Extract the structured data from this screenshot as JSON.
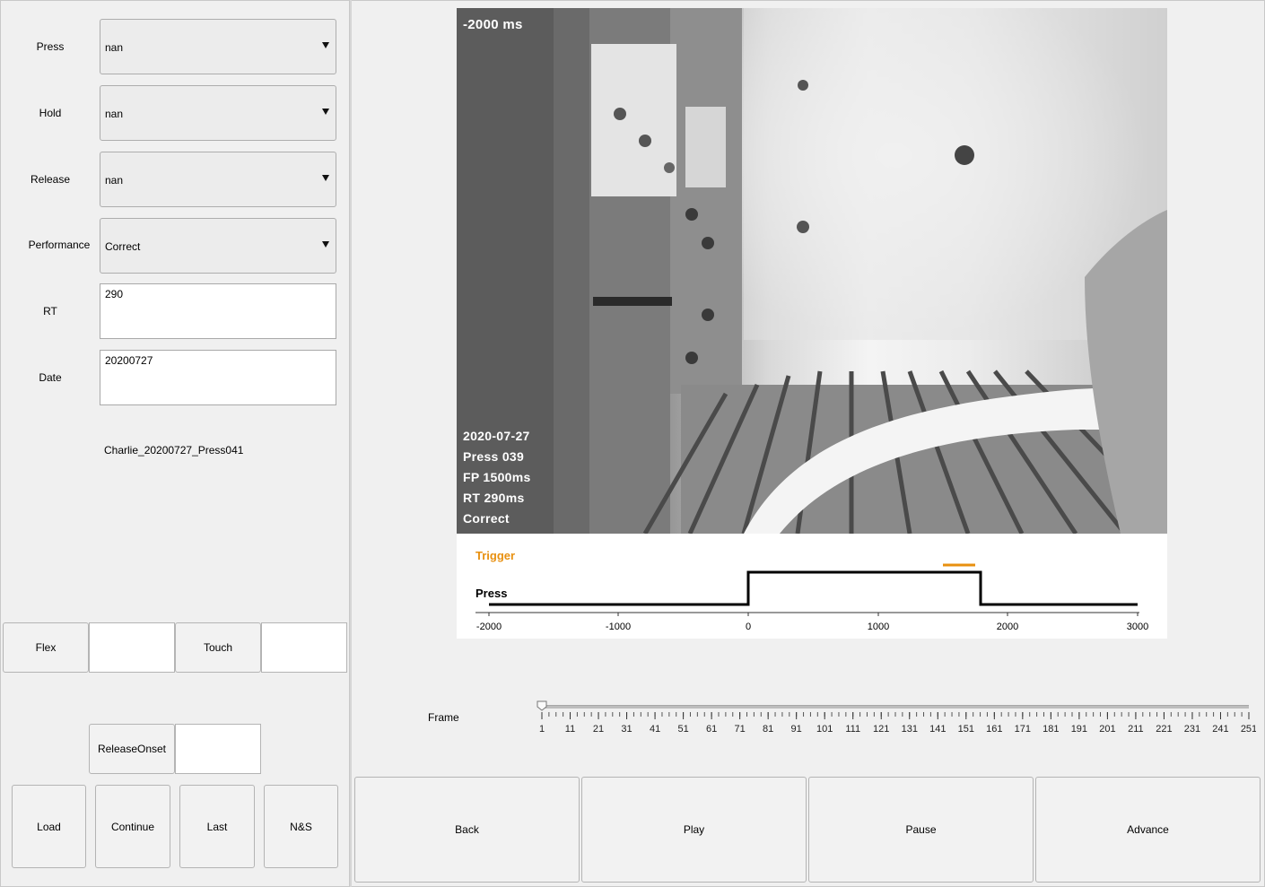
{
  "fields": {
    "press": {
      "label": "Press",
      "value": "nan"
    },
    "hold": {
      "label": "Hold",
      "value": "nan"
    },
    "release": {
      "label": "Release",
      "value": "nan"
    },
    "performance": {
      "label": "Performance",
      "value": "Correct"
    },
    "rt": {
      "label": "RT",
      "value": "290"
    },
    "date": {
      "label": "Date",
      "value": "20200727"
    }
  },
  "file_name": "Charlie_20200727_Press041",
  "buttons": {
    "flex": "Flex",
    "touch": "Touch",
    "release_onset": "ReleaseOnset",
    "load": "Load",
    "continue": "Continue",
    "last": "Last",
    "ns": "N&S",
    "back": "Back",
    "play": "Play",
    "pause": "Pause",
    "advance": "Advance"
  },
  "video": {
    "time_label": "-2000 ms",
    "time_color": "#f2d11a",
    "info_lines": [
      "2020-07-27",
      "Press 039",
      "FP 1500ms",
      "RT 290ms",
      "Correct"
    ]
  },
  "trace": {
    "trigger_label": "Trigger",
    "trigger_color": "#e8900f",
    "press_label": "Press",
    "x_ticks": [
      "-2000",
      "-1000",
      "0",
      "1000",
      "2000",
      "3000"
    ]
  },
  "frame": {
    "label": "Frame",
    "current": 1,
    "min": 1,
    "max": 251,
    "tick_labels": [
      "1",
      "11",
      "21",
      "31",
      "41",
      "51",
      "61",
      "71",
      "81",
      "91",
      "101",
      "111",
      "121",
      "131",
      "141",
      "151",
      "161",
      "171",
      "181",
      "191",
      "201",
      "211",
      "221",
      "231",
      "241",
      "251"
    ]
  }
}
